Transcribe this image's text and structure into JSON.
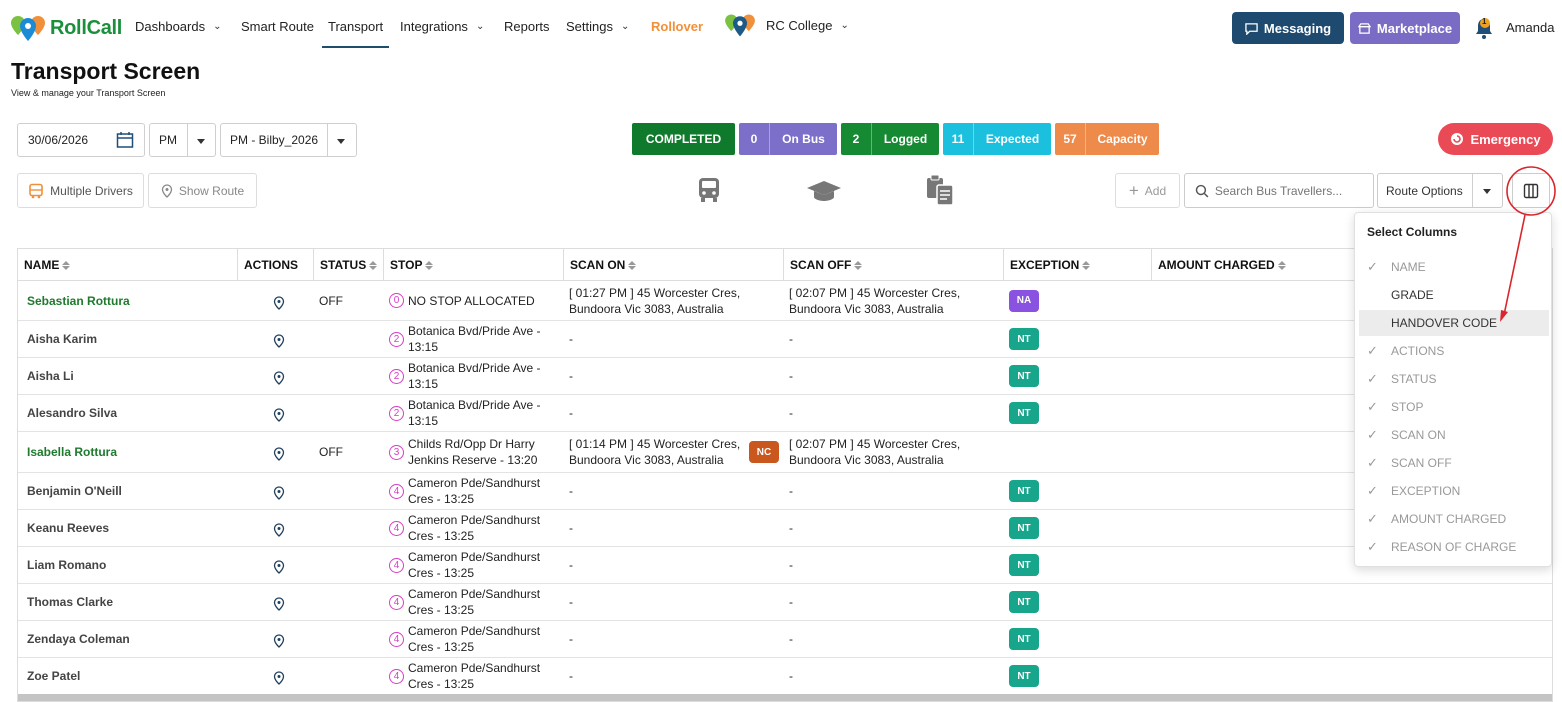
{
  "nav": {
    "brand": "RollCall",
    "items": [
      {
        "label": "Dashboards",
        "has_dropdown": true
      },
      {
        "label": "Smart Route",
        "has_dropdown": false
      },
      {
        "label": "Transport",
        "has_dropdown": false,
        "active": true
      },
      {
        "label": "Integrations",
        "has_dropdown": true
      },
      {
        "label": "Reports",
        "has_dropdown": false
      },
      {
        "label": "Settings",
        "has_dropdown": true
      },
      {
        "label": "Rollover",
        "has_dropdown": false,
        "color": "#f0903a"
      }
    ],
    "school": "RC College",
    "messaging_label": "Messaging",
    "marketplace_label": "Marketplace",
    "notification_count": "1",
    "user_name": "Amanda"
  },
  "page": {
    "title": "Transport Screen",
    "subtitle": "View & manage your Transport Screen"
  },
  "filters": {
    "date": "30/06/2026",
    "period": "PM",
    "route": "PM - Bilby_2026"
  },
  "stats": {
    "completed_label": "COMPLETED",
    "on_bus": {
      "value": "0",
      "label": "On Bus"
    },
    "logged": {
      "value": "2",
      "label": "Logged"
    },
    "expected": {
      "value": "11",
      "label": "Expected"
    },
    "capacity": {
      "value": "57",
      "label": "Capacity"
    },
    "emergency_label": "Emergency"
  },
  "toolbar": {
    "multiple_drivers_label": "Multiple Drivers",
    "show_route_label": "Show Route",
    "add_label": "Add",
    "search_placeholder": "Search Bus Travellers...",
    "route_options_label": "Route Options"
  },
  "table": {
    "columns": [
      "NAME",
      "ACTIONS",
      "STATUS",
      "STOP",
      "SCAN ON",
      "SCAN OFF",
      "EXCEPTION",
      "AMOUNT CHARGED"
    ],
    "rows": [
      {
        "name": "Sebastian Rottura",
        "status": "OFF",
        "stop_num": "0",
        "stop_line1": "NO STOP ALLOCATED",
        "stop_line2": "",
        "scan_on_line1": "[ 01:27 PM ] 45 Worcester Cres,",
        "scan_on_line2": "Bundoora Vic 3083, Australia",
        "scan_on_badge": "",
        "scan_off_line1": "[ 02:07 PM ] 45 Worcester Cres,",
        "scan_off_line2": "Bundoora Vic 3083, Australia",
        "exception": "NA"
      },
      {
        "name": "Aisha Karim",
        "status": "",
        "stop_num": "2",
        "stop_line1": "Botanica Bvd/Pride Ave -",
        "stop_line2": "13:15",
        "scan_on_line1": "-",
        "scan_on_line2": "",
        "scan_on_badge": "",
        "scan_off_line1": "-",
        "scan_off_line2": "",
        "exception": "NT"
      },
      {
        "name": "Aisha Li",
        "status": "",
        "stop_num": "2",
        "stop_line1": "Botanica Bvd/Pride Ave -",
        "stop_line2": "13:15",
        "scan_on_line1": "-",
        "scan_on_line2": "",
        "scan_on_badge": "",
        "scan_off_line1": "-",
        "scan_off_line2": "",
        "exception": "NT"
      },
      {
        "name": "Alesandro Silva",
        "status": "",
        "stop_num": "2",
        "stop_line1": "Botanica Bvd/Pride Ave -",
        "stop_line2": "13:15",
        "scan_on_line1": "-",
        "scan_on_line2": "",
        "scan_on_badge": "",
        "scan_off_line1": "-",
        "scan_off_line2": "",
        "exception": "NT"
      },
      {
        "name": "Isabella Rottura",
        "status": "OFF",
        "stop_num": "3",
        "stop_line1": "Childs Rd/Opp Dr Harry",
        "stop_line2": "Jenkins Reserve - 13:20",
        "scan_on_line1": "[ 01:14 PM ] 45 Worcester Cres,",
        "scan_on_line2": "Bundoora Vic 3083, Australia",
        "scan_on_badge": "NC",
        "scan_off_line1": "[ 02:07 PM ] 45 Worcester Cres,",
        "scan_off_line2": "Bundoora Vic 3083, Australia",
        "exception": ""
      },
      {
        "name": "Benjamin O'Neill",
        "status": "",
        "stop_num": "4",
        "stop_line1": "Cameron Pde/Sandhurst",
        "stop_line2": "Cres - 13:25",
        "scan_on_line1": "-",
        "scan_on_line2": "",
        "scan_on_badge": "",
        "scan_off_line1": "-",
        "scan_off_line2": "",
        "exception": "NT"
      },
      {
        "name": "Keanu Reeves",
        "status": "",
        "stop_num": "4",
        "stop_line1": "Cameron Pde/Sandhurst",
        "stop_line2": "Cres - 13:25",
        "scan_on_line1": "-",
        "scan_on_line2": "",
        "scan_on_badge": "",
        "scan_off_line1": "-",
        "scan_off_line2": "",
        "exception": "NT"
      },
      {
        "name": "Liam Romano",
        "status": "",
        "stop_num": "4",
        "stop_line1": "Cameron Pde/Sandhurst",
        "stop_line2": "Cres - 13:25",
        "scan_on_line1": "-",
        "scan_on_line2": "",
        "scan_on_badge": "",
        "scan_off_line1": "-",
        "scan_off_line2": "",
        "exception": "NT"
      },
      {
        "name": "Thomas Clarke",
        "status": "",
        "stop_num": "4",
        "stop_line1": "Cameron Pde/Sandhurst",
        "stop_line2": "Cres - 13:25",
        "scan_on_line1": "-",
        "scan_on_line2": "",
        "scan_on_badge": "",
        "scan_off_line1": "-",
        "scan_off_line2": "",
        "exception": "NT"
      },
      {
        "name": "Zendaya Coleman",
        "status": "",
        "stop_num": "4",
        "stop_line1": "Cameron Pde/Sandhurst",
        "stop_line2": "Cres - 13:25",
        "scan_on_line1": "-",
        "scan_on_line2": "",
        "scan_on_badge": "",
        "scan_off_line1": "-",
        "scan_off_line2": "",
        "exception": "NT"
      },
      {
        "name": "Zoe Patel",
        "status": "",
        "stop_num": "4",
        "stop_line1": "Cameron Pde/Sandhurst",
        "stop_line2": "Cres - 13:25",
        "scan_on_line1": "-",
        "scan_on_line2": "",
        "scan_on_badge": "",
        "scan_off_line1": "-",
        "scan_off_line2": "",
        "exception": "NT"
      }
    ]
  },
  "column_menu": {
    "title": "Select Columns",
    "items": [
      {
        "label": "NAME",
        "checked": true
      },
      {
        "label": "GRADE",
        "checked": false
      },
      {
        "label": "HANDOVER CODE",
        "checked": false,
        "highlighted": true
      },
      {
        "label": "ACTIONS",
        "checked": true
      },
      {
        "label": "STATUS",
        "checked": true
      },
      {
        "label": "STOP",
        "checked": true
      },
      {
        "label": "SCAN ON",
        "checked": true
      },
      {
        "label": "SCAN OFF",
        "checked": true
      },
      {
        "label": "EXCEPTION",
        "checked": true
      },
      {
        "label": "AMOUNT CHARGED",
        "checked": true
      },
      {
        "label": "REASON OF CHARGE",
        "checked": true
      }
    ]
  },
  "colors": {
    "completed": "#0f7a2c",
    "on_bus": "#7b6fc9",
    "logged": "#168a33",
    "expected": "#1ac0dd",
    "capacity": "#ee8a4a",
    "emergency": "#ea4a55",
    "annotation": "#d9262b"
  }
}
